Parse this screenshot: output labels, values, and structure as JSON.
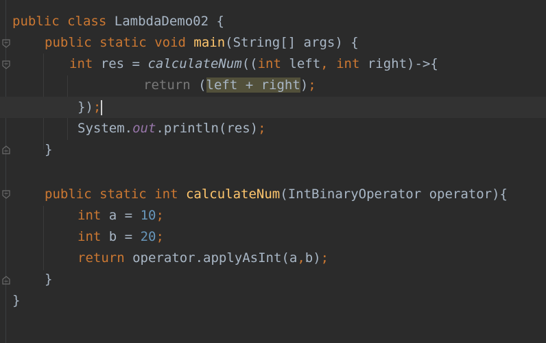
{
  "editor": {
    "language": "java",
    "lines": {
      "l1": {
        "kw1": "public",
        "kw2": "class",
        "name": "LambdaDemo02",
        "brace": "{"
      },
      "l2": {
        "kw1": "public",
        "kw2": "static",
        "kw3": "void",
        "fn": "main",
        "rest": "(String[] args) {"
      },
      "l3": {
        "kw1": "int",
        "var": "res =",
        "fn": "calculateNum",
        "p1": "((",
        "kw2": "int",
        "a1": "left",
        "comma": ",",
        "kw3": "int",
        "a2": "right)->{"
      },
      "l4": {
        "kw": "return",
        "open": "(",
        "expr": "left + right",
        "close": ")",
        "semi": ";"
      },
      "l5": {
        "text": "})",
        "semi": ";"
      },
      "l6": {
        "cls": "System.",
        "field": "out",
        "call": ".println(res)",
        "semi": ";"
      },
      "l7": {
        "text": "}"
      },
      "l9": {
        "kw1": "public",
        "kw2": "static",
        "kw3": "int",
        "fn": "calculateNum",
        "rest": "(IntBinaryOperator operator){"
      },
      "l10": {
        "kw": "int",
        "var": "a =",
        "num": "10",
        "semi": ";"
      },
      "l11": {
        "kw": "int",
        "var": "b =",
        "num": "20",
        "semi": ";"
      },
      "l12": {
        "kw": "return",
        "call": "operator.applyAsInt(a",
        "comma": ",",
        "arg": "b)",
        "semi": ";"
      },
      "l13": {
        "text": "}"
      },
      "l14": {
        "text": "}"
      }
    },
    "colors": {
      "background": "#2b2b2b",
      "keyword": "#cc7832",
      "function": "#ffc66d",
      "number": "#6897bb",
      "field": "#9876aa",
      "text": "#a9b7c6"
    },
    "icons": [
      "fold-marker-icon"
    ]
  }
}
